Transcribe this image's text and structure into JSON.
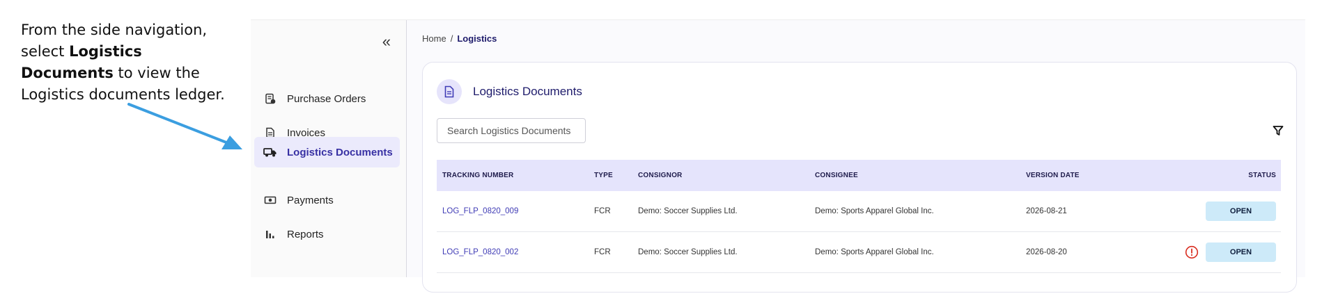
{
  "callout": {
    "line_prefix": "From the side navigation, select ",
    "bold": "Logistics Documents",
    "line_suffix": " to view the Logistics documents ledger."
  },
  "sidebar": {
    "collapse_glyph": "«",
    "items": [
      {
        "label": "Purchase Orders",
        "icon": "purchase-order-icon"
      },
      {
        "label": "Invoices",
        "icon": "invoice-icon"
      },
      {
        "label": "Logistics Documents",
        "icon": "truck-icon",
        "active": true
      },
      {
        "label": "Payments",
        "icon": "payment-icon"
      },
      {
        "label": "Reports",
        "icon": "bar-chart-icon"
      }
    ]
  },
  "breadcrumb": {
    "home": "Home",
    "separator": "/",
    "current": "Logistics"
  },
  "card": {
    "title": "Logistics Documents",
    "search_placeholder": "Search Logistics Documents"
  },
  "table": {
    "headers": [
      "TRACKING NUMBER",
      "TYPE",
      "CONSIGNOR",
      "CONSIGNEE",
      "VERSION DATE",
      "STATUS"
    ],
    "rows": [
      {
        "tracking": "LOG_FLP_0820_009",
        "type": "FCR",
        "consignor": "Demo: Soccer Supplies Ltd.",
        "consignee": "Demo: Sports Apparel Global Inc.",
        "date": "2026-08-21",
        "status": "OPEN",
        "warning": false
      },
      {
        "tracking": "LOG_FLP_0820_002",
        "type": "FCR",
        "consignor": "Demo: Soccer Supplies Ltd.",
        "consignee": "Demo: Sports Apparel Global Inc.",
        "date": "2026-08-20",
        "status": "OPEN",
        "warning": true
      }
    ]
  },
  "colors": {
    "accent": "#3730a3",
    "header_bg": "#e5e4fc",
    "status_bg": "#cdeaf9",
    "arrow": "#3b9ee0",
    "warning": "#d92d20"
  }
}
